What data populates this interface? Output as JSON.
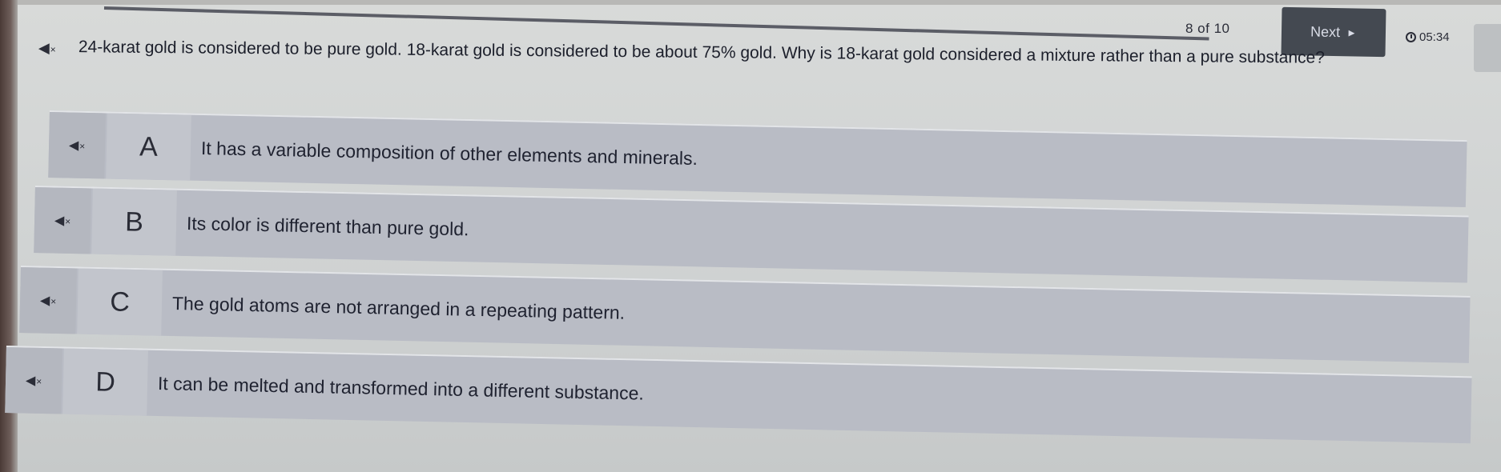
{
  "header": {
    "progress": "8 of 10",
    "next_label": "Next",
    "next_arrow": "►",
    "timer": "05:34"
  },
  "question": {
    "audio_icon": "speaker-muted-icon",
    "text": "24-karat gold is considered to be pure gold. 18-karat gold is considered to be about 75% gold. Why is 18-karat gold considered a mixture rather than a pure substance?"
  },
  "options": [
    {
      "letter": "A",
      "text": "It has a variable composition of other elements and minerals."
    },
    {
      "letter": "B",
      "text": "Its color is different than pure gold."
    },
    {
      "letter": "C",
      "text": "The gold atoms are not arranged in a repeating pattern."
    },
    {
      "letter": "D",
      "text": "It can be melted and transformed into a different substance."
    }
  ],
  "colors": {
    "option_bg": "#b9bcc5",
    "next_button_bg": "#444951"
  }
}
